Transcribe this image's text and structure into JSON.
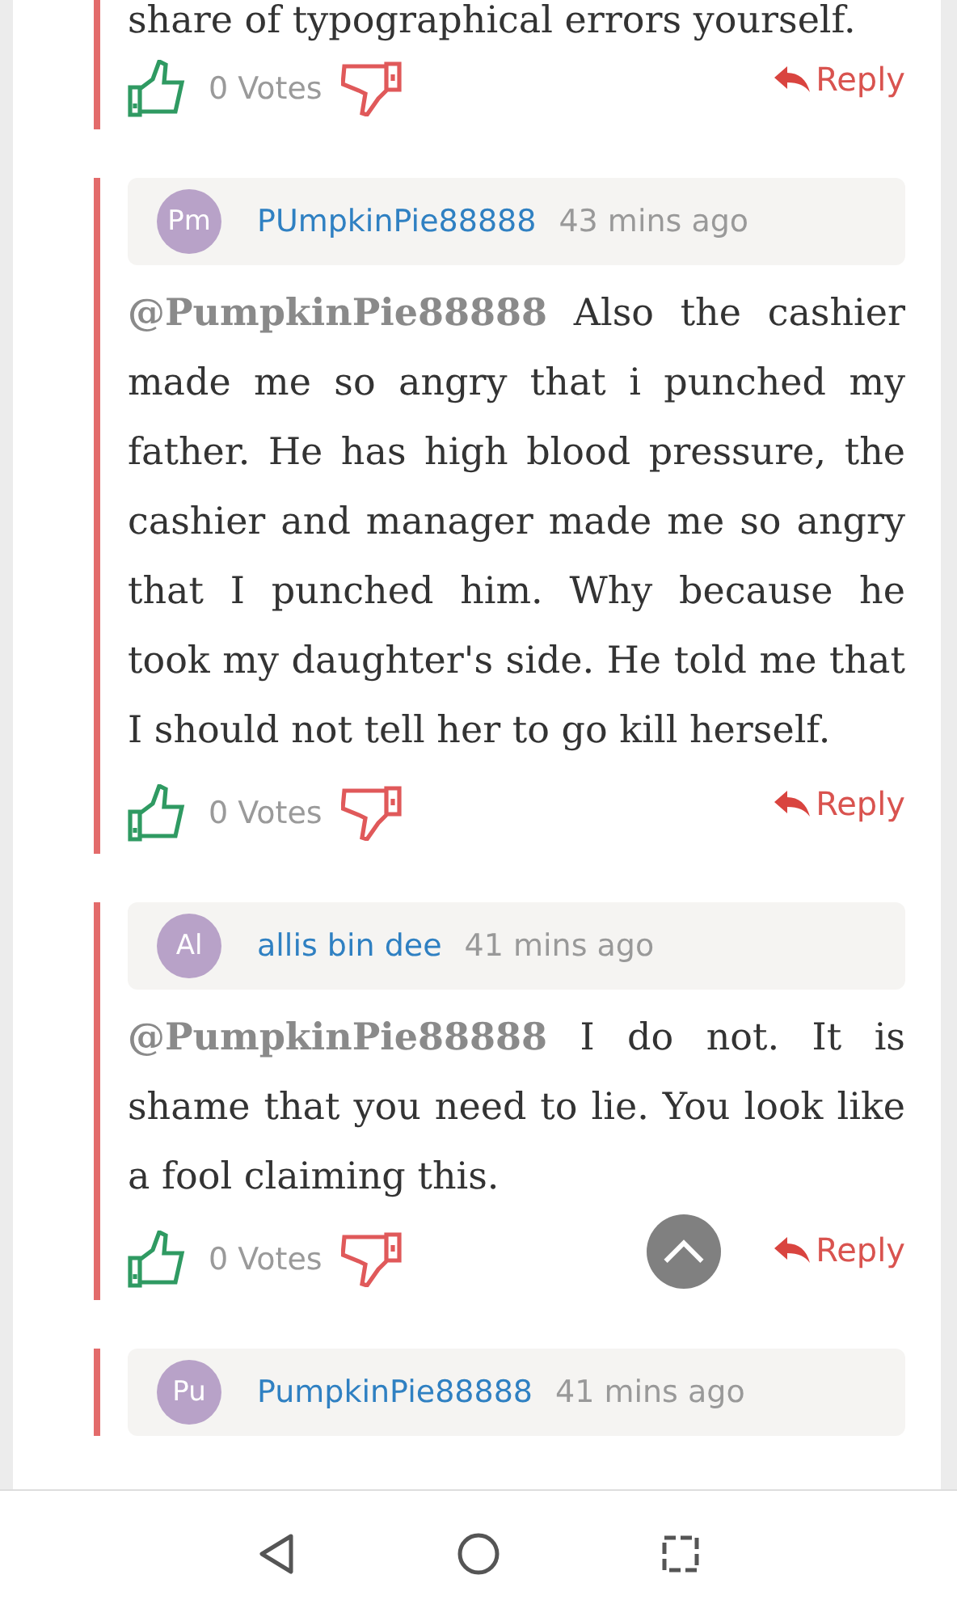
{
  "comments": [
    {
      "body": "share of typographical errors yourself.",
      "votes": "0 Votes",
      "reply": "Reply"
    },
    {
      "avatar": "Pm",
      "author": "PUmpkinPie88888",
      "time": "43 mins ago",
      "body": "**@PumpkinPie88888** Also the cashier made me so angry that i punched my father. He has high blood pressure, the cashier and manager made me so angry that I punched him. Why because he took my daughter's side. He told me that I should not tell her to go kill herself.",
      "votes": "0 Votes",
      "reply": "Reply"
    },
    {
      "avatar": "Al",
      "author": "allis bin dee",
      "time": "41 mins ago",
      "body": "**@PumpkinPie88888** I do not. It is shame that you need to lie. You look like a fool claiming this.",
      "votes": "0 Votes",
      "reply": "Reply"
    },
    {
      "avatar": "Pu",
      "author": "PumpkinPie88888",
      "time": "41 mins ago"
    }
  ]
}
